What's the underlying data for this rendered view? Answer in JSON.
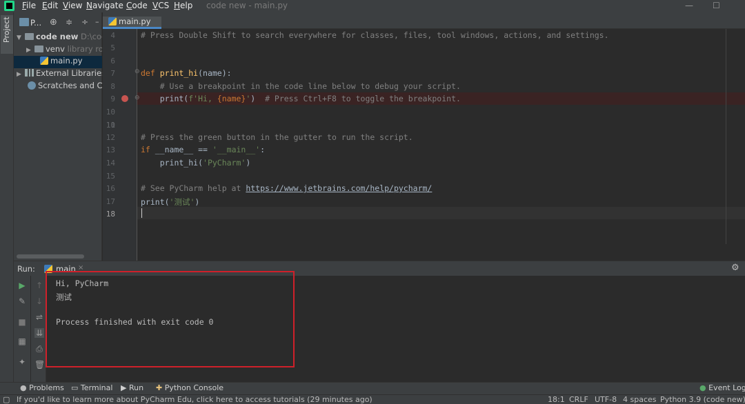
{
  "window": {
    "title": "code new - main.py"
  },
  "menu": [
    "File",
    "Edit",
    "View",
    "Navigate",
    "Code",
    "VCS",
    "Help"
  ],
  "window_controls": {
    "minimize": "—",
    "maximize": "☐"
  },
  "project_panel": {
    "tab_label": "Project",
    "dropdown_label": "P...",
    "tree": [
      {
        "label": "code new",
        "suffix": "D:\\cod",
        "type": "folder",
        "expanded": true
      },
      {
        "label": "venv",
        "suffix": "library ro",
        "type": "folder",
        "expanded": false
      },
      {
        "label": "main.py",
        "type": "python",
        "selected": true
      },
      {
        "label": "External Libraries",
        "type": "library"
      },
      {
        "label": "Scratches and Cor",
        "type": "scratch"
      }
    ]
  },
  "editor": {
    "tab_label": "main.py",
    "lines": [
      {
        "n": "4",
        "text": "# Press Double Shift to search everywhere for classes, files, tool windows, actions, and settings."
      },
      {
        "n": "5",
        "text": ""
      },
      {
        "n": "6",
        "text": ""
      },
      {
        "n": "7",
        "text_def": "def",
        "text_fn": "print_hi",
        "text_rest": "(name):"
      },
      {
        "n": "8",
        "text": "    # Use a breakpoint in the code line below to debug your script."
      },
      {
        "n": "9",
        "text_a": "    print(",
        "text_b": "f'Hi, ",
        "text_c": "{name}",
        "text_d": "'",
        "text_e": ")  ",
        "text_f": "# Press Ctrl+F8 to toggle the breakpoint."
      },
      {
        "n": "10",
        "text": ""
      },
      {
        "n": "11",
        "text": ""
      },
      {
        "n": "12",
        "text": "# Press the green button in the gutter to run the script."
      },
      {
        "n": "13",
        "text_if": "if",
        "text_name": " __name__ == ",
        "text_str": "'__main__'",
        "text_end": ":"
      },
      {
        "n": "14",
        "text_a": "    print_hi(",
        "text_b": "'PyCharm'",
        "text_c": ")"
      },
      {
        "n": "15",
        "text": ""
      },
      {
        "n": "16",
        "text_a": "# See PyCharm help at ",
        "text_b": "https://www.jetbrains.com/help/pycharm/"
      },
      {
        "n": "17",
        "text_a": "print(",
        "text_b": "'测试'",
        "text_c": ")"
      },
      {
        "n": "18",
        "text": ""
      }
    ]
  },
  "run_panel": {
    "label": "Run:",
    "config_tab": "main",
    "output": [
      "Hi, PyCharm",
      "测试",
      "",
      "Process finished with exit code 0"
    ]
  },
  "bottom_tabs": [
    "Problems",
    "Terminal",
    "Run",
    "Python Console"
  ],
  "event_log": "Event Log",
  "status_bar": {
    "message": "If you'd like to learn more about PyCharm Edu, click here to access tutorials (29 minutes ago)",
    "position": "18:1",
    "line_sep": "CRLF",
    "encoding": "UTF-8",
    "indent": "4 spaces",
    "interpreter": "Python 3.9 (code new)"
  },
  "colors": {
    "breakpoint": "#c75450",
    "highlight_box": "#d0202a",
    "accent": "#4a88c7"
  }
}
